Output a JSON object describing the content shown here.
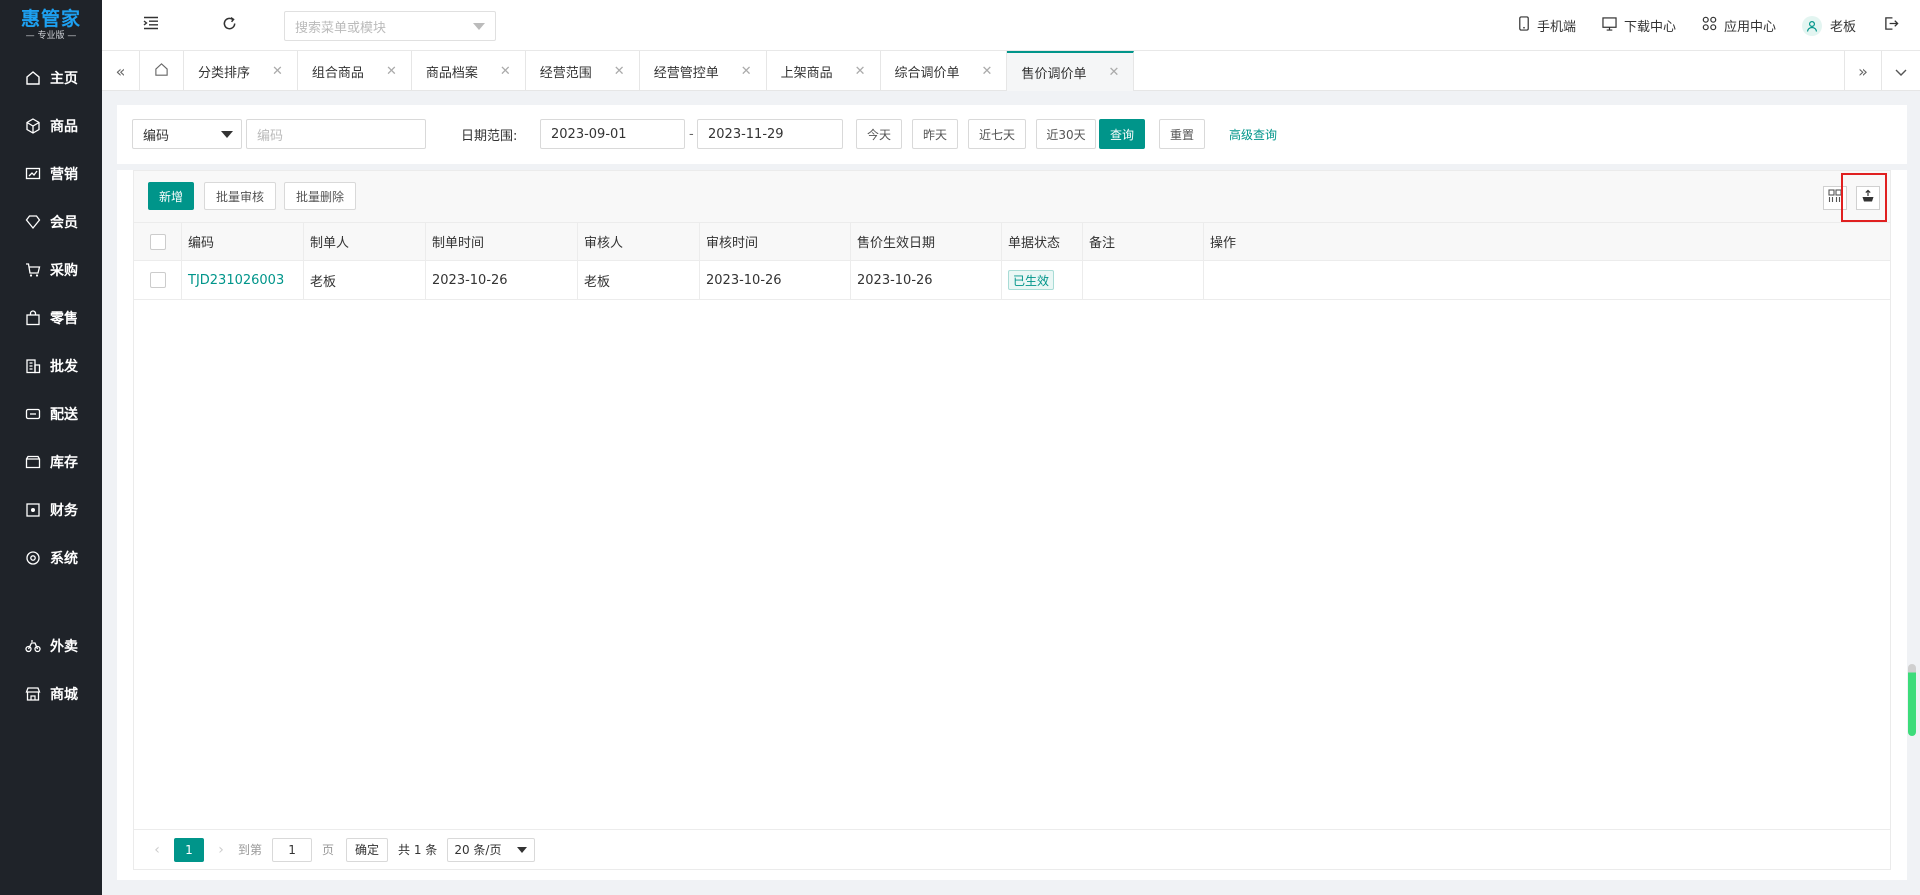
{
  "app": {
    "logo_main": "惠管家",
    "logo_sub": "— 专业版 —"
  },
  "sidebar": {
    "items": [
      {
        "label": "主页",
        "icon": "home-icon"
      },
      {
        "label": "商品",
        "icon": "cube-icon"
      },
      {
        "label": "营销",
        "icon": "chart-icon"
      },
      {
        "label": "会员",
        "icon": "diamond-icon"
      },
      {
        "label": "采购",
        "icon": "cart-icon"
      },
      {
        "label": "零售",
        "icon": "bag-icon"
      },
      {
        "label": "批发",
        "icon": "building-icon"
      },
      {
        "label": "配送",
        "icon": "truck-icon"
      },
      {
        "label": "库存",
        "icon": "box-icon"
      },
      {
        "label": "财务",
        "icon": "finance-icon"
      },
      {
        "label": "系统",
        "icon": "settings-icon"
      }
    ],
    "extra_items": [
      {
        "label": "外卖",
        "icon": "bike-icon"
      },
      {
        "label": "商城",
        "icon": "shop-icon"
      }
    ]
  },
  "header": {
    "search_placeholder": "搜索菜单或模块",
    "mobile": "手机端",
    "download": "下载中心",
    "apps": "应用中心",
    "user": "老板"
  },
  "tabs": [
    {
      "label": "分类排序",
      "active": false
    },
    {
      "label": "组合商品",
      "active": false
    },
    {
      "label": "商品档案",
      "active": false
    },
    {
      "label": "经营范围",
      "active": false
    },
    {
      "label": "经营管控单",
      "active": false
    },
    {
      "label": "上架商品",
      "active": false
    },
    {
      "label": "综合调价单",
      "active": false
    },
    {
      "label": "售价调价单",
      "active": true
    }
  ],
  "filter": {
    "field_select": "编码",
    "field_placeholder": "编码",
    "date_label": "日期范围:",
    "date_from": "2023-09-01",
    "date_sep": "-",
    "date_to": "2023-11-29",
    "today": "今天",
    "yesterday": "昨天",
    "last7": "近七天",
    "last30": "近30天",
    "search": "查询",
    "reset": "重置",
    "advanced": "高级查询"
  },
  "toolbar": {
    "add": "新增",
    "batch_review": "批量审核",
    "batch_delete": "批量删除"
  },
  "table": {
    "columns": [
      "编码",
      "制单人",
      "制单时间",
      "审核人",
      "审核时间",
      "售价生效日期",
      "单据状态",
      "备注",
      "操作"
    ],
    "rows": [
      {
        "code": "TJD231026003",
        "creator": "老板",
        "created": "2023-10-26",
        "reviewer": "老板",
        "reviewed": "2023-10-26",
        "effective": "2023-10-26",
        "status": "已生效",
        "remark": "",
        "action": ""
      }
    ]
  },
  "pager": {
    "page": "1",
    "goto_label": "到第",
    "goto_value": "1",
    "page_unit": "页",
    "ok": "确定",
    "total": "共 1 条",
    "page_size": "20 条/页"
  },
  "colors": {
    "accent": "#00958a",
    "sidebar_bg": "#1f2329",
    "logo": "#1da1f2",
    "highlight": "#e02020"
  }
}
